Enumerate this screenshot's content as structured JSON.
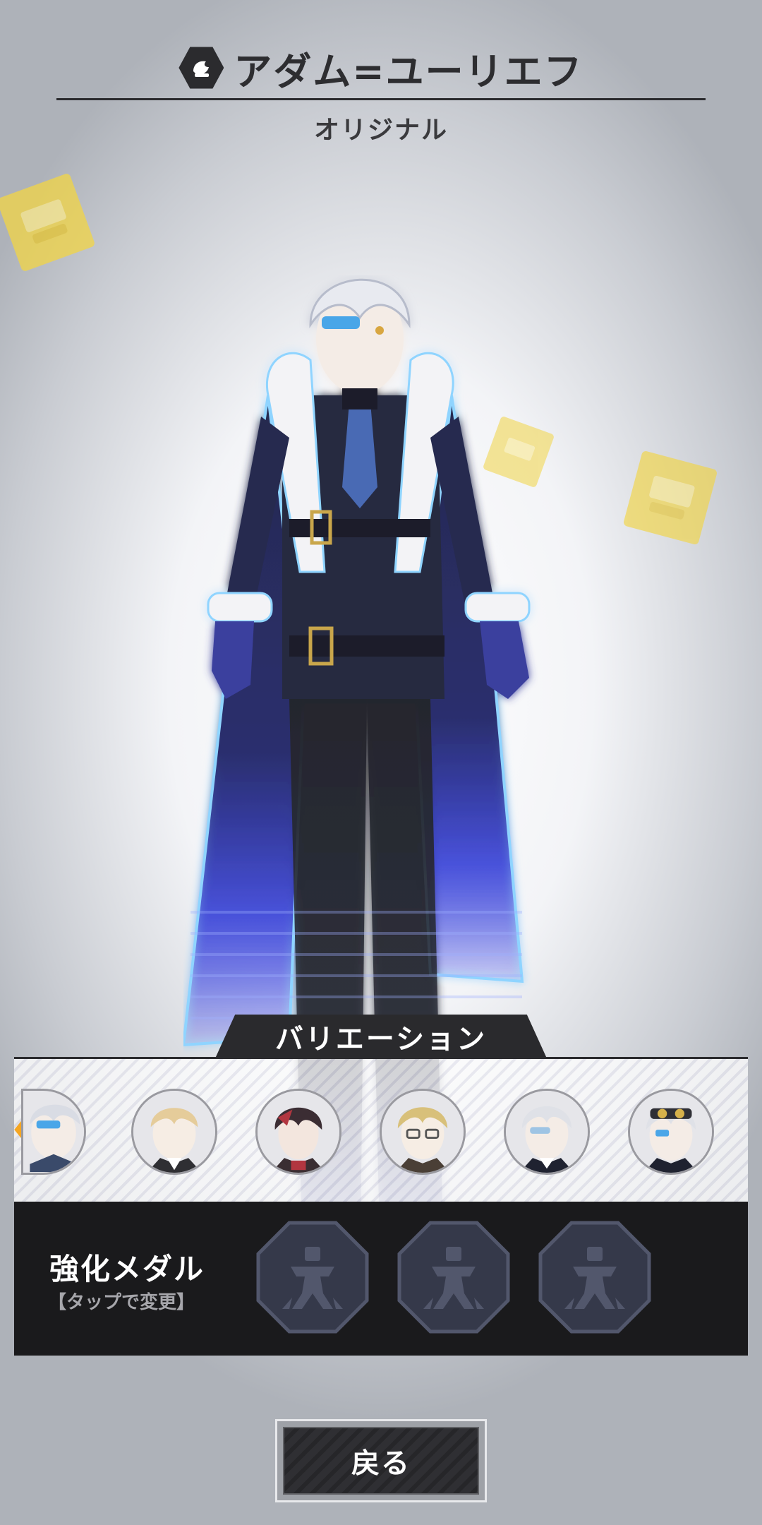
{
  "header": {
    "title": "アダム=ユーリエフ",
    "title_icon": "attribute-hex-icon",
    "subtitle": "オリジナル"
  },
  "variation": {
    "label": "バリエーション",
    "avatars": [
      {
        "icon": "variation-avatar-silver-hair-visor"
      },
      {
        "icon": "variation-avatar-blond-hair"
      },
      {
        "icon": "variation-avatar-dark-red-hair"
      },
      {
        "icon": "variation-avatar-blond-glasses"
      },
      {
        "icon": "variation-avatar-silver-hair"
      },
      {
        "icon": "variation-avatar-silver-goggles"
      }
    ],
    "scroll_left_icon": "chevron-left-icon"
  },
  "medal": {
    "label": "強化メダル",
    "hint": "【タップで変更】",
    "slots": 3,
    "slot_icon": "empty-medal-icon"
  },
  "back_button": {
    "label": "戻る"
  },
  "colors": {
    "accent_orange": "#f5a623",
    "dark_panel": "#1a1a1c",
    "deco_yellow": "#f2d545",
    "hologram_blue": "#3a46e0"
  }
}
